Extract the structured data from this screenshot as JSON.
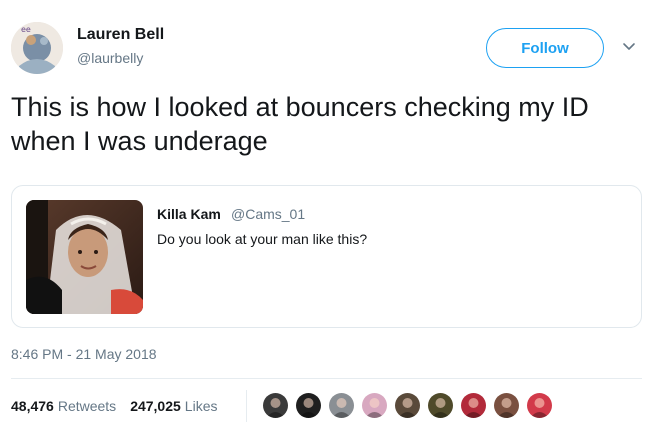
{
  "author": {
    "display_name": "Lauren Bell",
    "handle": "@laurbelly",
    "avatar_icon": "profile-avatar"
  },
  "follow_label": "Follow",
  "tweet_text": "This is how I looked at bouncers checking my ID when I was underage",
  "quoted_tweet": {
    "display_name": "Killa Kam",
    "handle": "@Cams_01",
    "text": "Do you look at your man like this?"
  },
  "timestamp": "8:46 PM - 21 May 2018",
  "stats": {
    "retweets_count": "48,476",
    "retweets_label": "Retweets",
    "likes_count": "247,025",
    "likes_label": "Likes"
  },
  "colors": {
    "accent": "#1da1f2",
    "muted": "#657786",
    "text": "#14171a",
    "border": "#e1e8ed"
  },
  "liker_avatars": [
    {
      "icon": "liker-avatar-1",
      "color": "#3a3a3a"
    },
    {
      "icon": "liker-avatar-2",
      "color": "#1f1f1f"
    },
    {
      "icon": "liker-avatar-3",
      "color": "#8a8f94"
    },
    {
      "icon": "liker-avatar-4",
      "color": "#d8a8c0"
    },
    {
      "icon": "liker-avatar-5",
      "color": "#5a4a3a"
    },
    {
      "icon": "liker-avatar-6",
      "color": "#4f4a2a"
    },
    {
      "icon": "liker-avatar-7",
      "color": "#b22a3a"
    },
    {
      "icon": "liker-avatar-8",
      "color": "#7a5040"
    },
    {
      "icon": "liker-avatar-9",
      "color": "#d23a4a"
    }
  ]
}
